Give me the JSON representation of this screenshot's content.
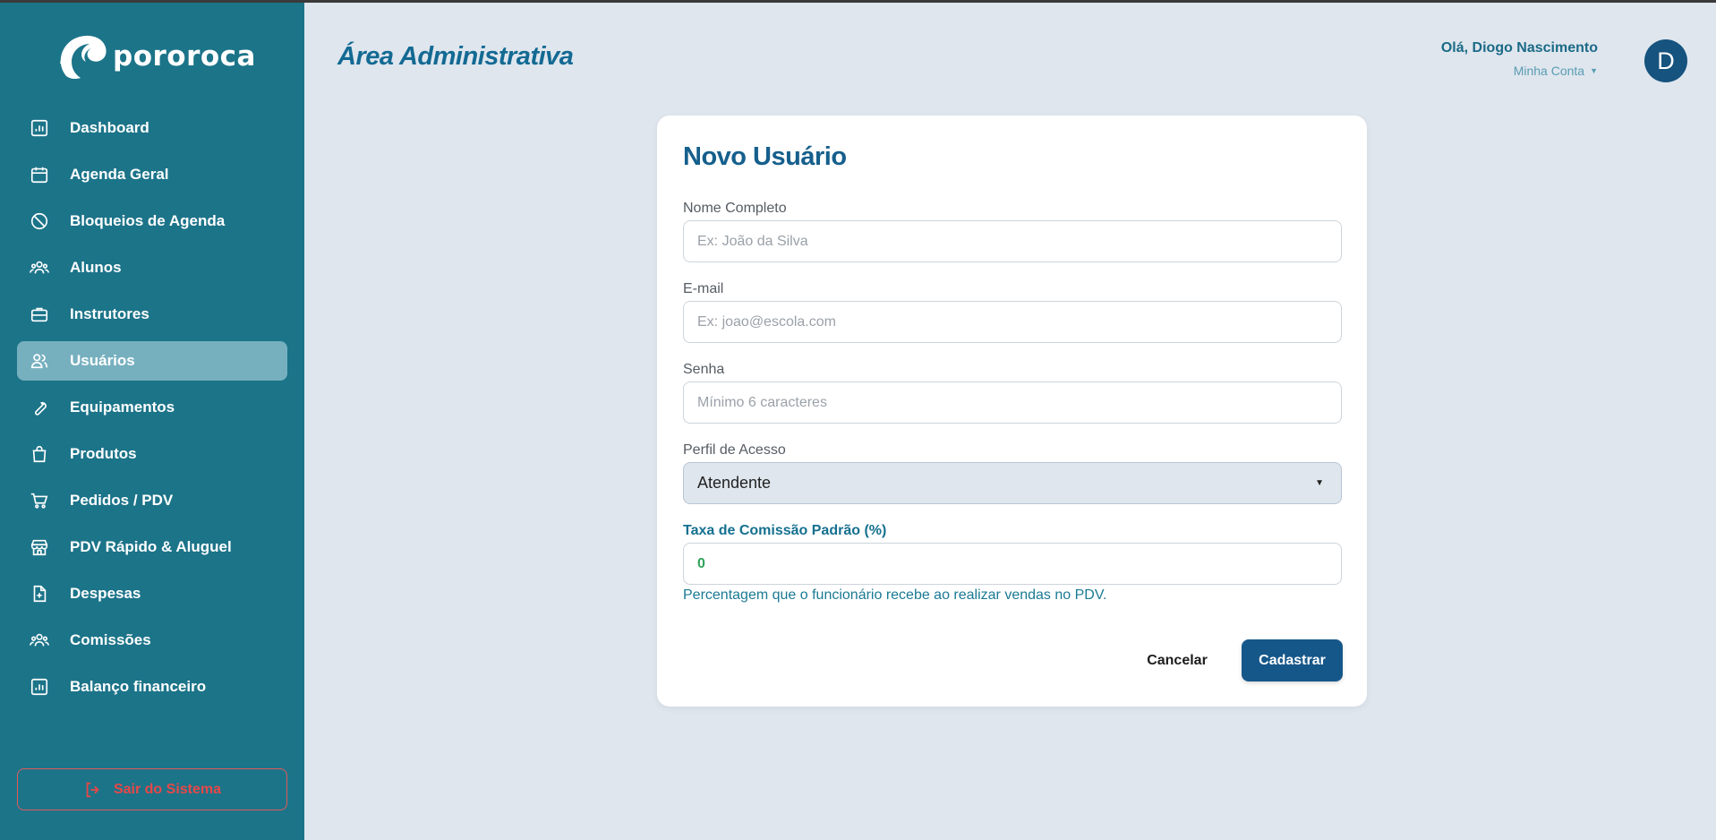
{
  "brand": {
    "name": "pororoca"
  },
  "header": {
    "title": "Área Administrativa",
    "greeting": "Olá, Diogo Nascimento",
    "account_menu": "Minha Conta",
    "avatar_letter": "D"
  },
  "sidebar": {
    "items": [
      {
        "label": "Dashboard",
        "icon": "bar-chart-icon"
      },
      {
        "label": "Agenda Geral",
        "icon": "calendar-icon"
      },
      {
        "label": "Bloqueios de Agenda",
        "icon": "ban-icon"
      },
      {
        "label": "Alunos",
        "icon": "group-icon"
      },
      {
        "label": "Instrutores",
        "icon": "briefcase-icon"
      },
      {
        "label": "Usuários",
        "icon": "users-icon",
        "active": true
      },
      {
        "label": "Equipamentos",
        "icon": "wrench-icon"
      },
      {
        "label": "Produtos",
        "icon": "shopping-bag-icon"
      },
      {
        "label": "Pedidos / PDV",
        "icon": "cart-icon"
      },
      {
        "label": "PDV Rápido & Aluguel",
        "icon": "store-icon"
      },
      {
        "label": "Despesas",
        "icon": "file-plus-icon"
      },
      {
        "label": "Comissões",
        "icon": "group-icon"
      },
      {
        "label": "Balanço financeiro",
        "icon": "bar-chart-icon"
      }
    ],
    "logout_label": "Sair do Sistema"
  },
  "form": {
    "title": "Novo Usuário",
    "name_label": "Nome Completo",
    "name_placeholder": "Ex: João da Silva",
    "email_label": "E-mail",
    "email_placeholder": "Ex: joao@escola.com",
    "password_label": "Senha",
    "password_placeholder": "Mínimo 6 caracteres",
    "profile_label": "Perfil de Acesso",
    "profile_value": "Atendente",
    "commission_label": "Taxa de Comissão Padrão (%)",
    "commission_value": "0",
    "commission_help": "Percentagem que o funcionário recebe ao realizar vendas no PDV.",
    "cancel_label": "Cancelar",
    "submit_label": "Cadastrar"
  },
  "colors": {
    "sidebar_bg": "#1c7489",
    "active_item_bg": "#76b0bf",
    "primary": "#16578a",
    "danger": "#e64848",
    "success": "#2fa35a"
  }
}
